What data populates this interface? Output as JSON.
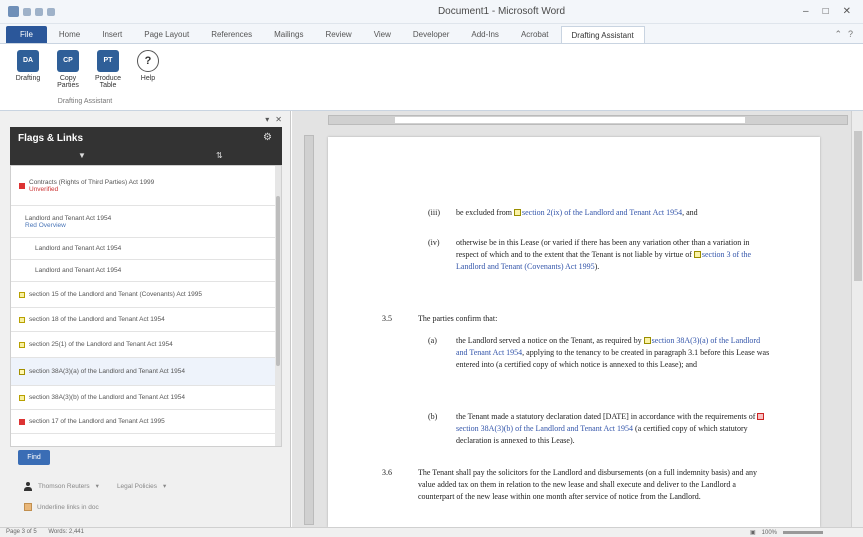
{
  "window": {
    "title": "Document1 - Microsoft Word"
  },
  "tabs": [
    "File",
    "Home",
    "Insert",
    "Page Layout",
    "References",
    "Mailings",
    "Review",
    "View",
    "Developer",
    "Add-Ins",
    "Acrobat",
    "Drafting Assistant"
  ],
  "ribbon": {
    "buttons": [
      {
        "label": "Drafting",
        "icon": "DA"
      },
      {
        "label": "Copy Parties",
        "icon": "CP"
      },
      {
        "label": "Produce Table",
        "icon": "PT"
      },
      {
        "label": "Help",
        "icon": "?"
      }
    ],
    "group_label": "Drafting Assistant"
  },
  "pane": {
    "title": "Flags & Links",
    "items": [
      {
        "text": "Contracts (Rights of Third Parties) Act 1999",
        "sub": "Unverified",
        "flag": "red"
      },
      {
        "text": "Landlord and Tenant Act 1954",
        "sub": "Red Overview",
        "flag": "none"
      },
      {
        "text": "Landlord and Tenant Act 1954",
        "sub": "",
        "flag": "none"
      },
      {
        "text": "Landlord and Tenant Act 1954",
        "sub": "",
        "flag": "none"
      },
      {
        "text": "section 15 of the Landlord and Tenant (Covenants) Act 1995",
        "sub": "",
        "flag": "yellow"
      },
      {
        "text": "section 18 of the Landlord and Tenant Act 1954",
        "sub": "",
        "flag": "yellow"
      },
      {
        "text": "section 25(1) of the Landlord and Tenant Act 1954",
        "sub": "",
        "flag": "yellow"
      },
      {
        "text": "section 38A(3)(a) of the Landlord and Tenant Act 1954",
        "sub": "",
        "flag": "yellow"
      },
      {
        "text": "section 38A(3)(b) of the Landlord and Tenant Act 1954",
        "sub": "",
        "flag": "yellow"
      },
      {
        "text": "section 17 of the Landlord and Tenant Act 1995",
        "sub": "",
        "flag": "red"
      }
    ],
    "find_label": "Find",
    "user_label": "Thomson Reuters",
    "options_label": "Legal Policies",
    "underline_label": "Underline links in doc"
  },
  "document": {
    "paragraphs": [
      {
        "num": "(iii)",
        "text": "be excluded from ",
        "link": "section 2(ix) of the Landlord and Tenant Act 1954",
        "rest": ", and",
        "mark": "yellow"
      },
      {
        "num": "(iv)",
        "text": "otherwise be in this Lease (or varied if there has been any variation other than a variation in respect of which and to the extent that the Tenant is not liable by virtue of ",
        "link": "section 3 of the Landlord and Tenant (Covenants) Act 1995",
        "rest": ").",
        "mark": "yellow"
      },
      {
        "num": "3.5",
        "text": "The parties confirm that:",
        "link": "",
        "rest": "",
        "mark": "none"
      },
      {
        "num": "(a)",
        "text": "the Landlord served a notice on the Tenant, as required by ",
        "link": "section 38A(3)(a) of the Landlord and Tenant Act 1954",
        "rest": ", applying to the tenancy to be created in paragraph 3.1 before this Lease was entered into (a certified copy of which notice is annexed to this Lease); and",
        "mark": "yellow"
      },
      {
        "num": "(b)",
        "text": "the Tenant made a statutory declaration dated [DATE] in accordance with the requirements of ",
        "link": "section 38A(3)(b) of the Landlord and Tenant Act 1954",
        "rest": " (a certified copy of which statutory declaration is annexed to this Lease).",
        "mark": "red"
      },
      {
        "num": "3.6",
        "text": "The Tenant shall pay the solicitors for the Landlord and disbursements (on a full indemnity basis) and any value added tax on them in relation to the new lease and shall execute and deliver to the Landlord a counterpart of the new lease within one month after service of notice from the Landlord.",
        "link": "",
        "rest": "",
        "mark": "none"
      }
    ]
  },
  "status": {
    "page": "Page 3 of 5",
    "words": "Words: 2,441",
    "zoom": "100%"
  }
}
